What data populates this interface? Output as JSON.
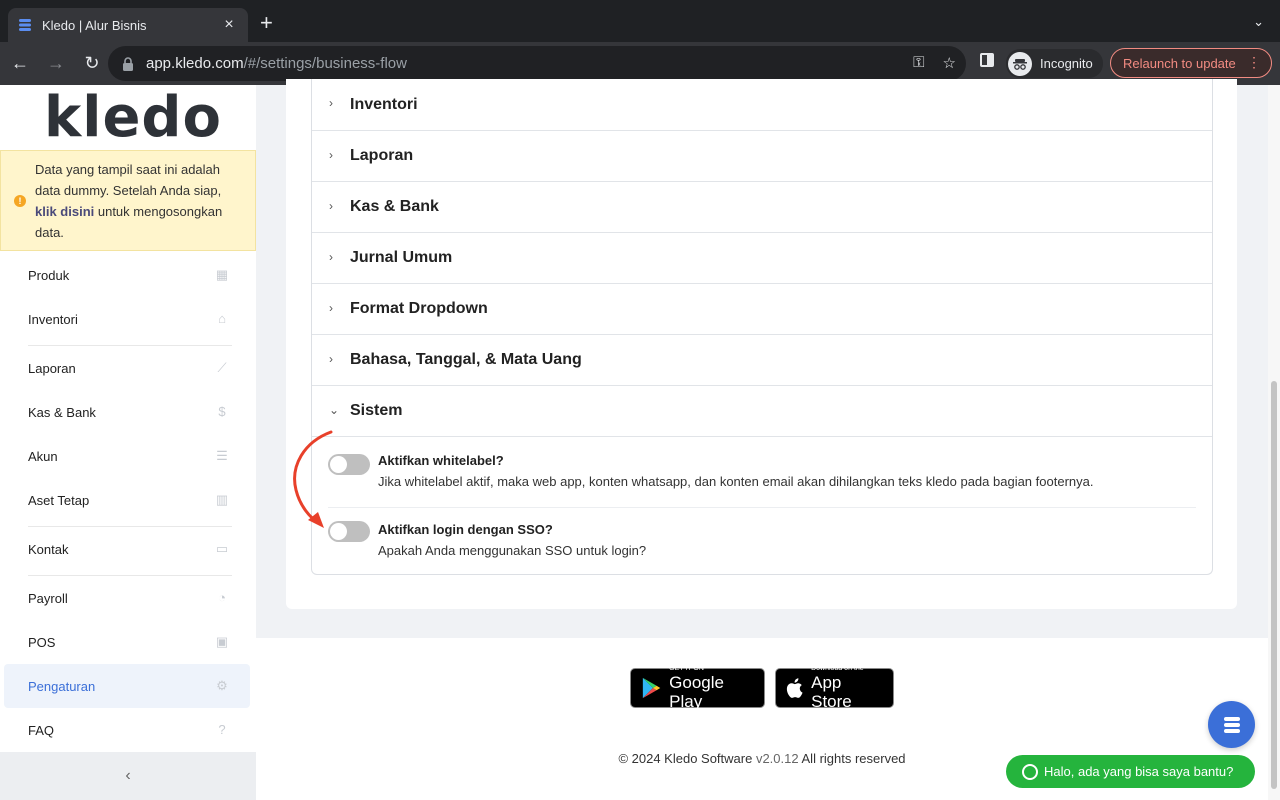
{
  "browser": {
    "tab_title": "Kledo | Alur Bisnis",
    "url_host": "app.kledo.com",
    "url_path": "/#/settings/business-flow",
    "profile_label": "Incognito",
    "relaunch_label": "Relaunch to update"
  },
  "sidebar": {
    "logo_text": "kledo",
    "notice": {
      "text_before": "Data yang tampil saat ini adalah data dummy. Setelah Anda siap, ",
      "link": "klik disini",
      "text_after": " untuk mengosongkan data."
    },
    "items": [
      {
        "label": "Produk",
        "icon": "box-icon"
      },
      {
        "label": "Inventori",
        "icon": "warehouse-icon"
      },
      {
        "label": "Laporan",
        "icon": "chart-icon"
      },
      {
        "label": "Kas & Bank",
        "icon": "dollar-icon"
      },
      {
        "label": "Akun",
        "icon": "list-icon"
      },
      {
        "label": "Aset Tetap",
        "icon": "building-icon"
      },
      {
        "label": "Kontak",
        "icon": "contact-card-icon"
      },
      {
        "label": "Payroll",
        "icon": "payroll-icon"
      },
      {
        "label": "POS",
        "icon": "pos-icon"
      },
      {
        "label": "Pengaturan",
        "icon": "gear-icon"
      },
      {
        "label": "FAQ",
        "icon": "question-icon"
      }
    ],
    "collapse_label": "‹"
  },
  "accordion": {
    "sections": [
      "Inventori",
      "Laporan",
      "Kas & Bank",
      "Jurnal Umum",
      "Format Dropdown",
      "Bahasa, Tanggal, & Mata Uang"
    ],
    "open_section": "Sistem",
    "settings": [
      {
        "title": "Aktifkan whitelabel?",
        "description": "Jika whitelabel aktif, maka web app, konten whatsapp, dan konten email akan dihilangkan teks kledo pada bagian footernya.",
        "enabled": false
      },
      {
        "title": "Aktifkan login dengan SSO?",
        "description": "Apakah Anda menggunakan SSO untuk login?",
        "enabled": false
      }
    ]
  },
  "footer": {
    "google_play": {
      "small": "GET IT ON",
      "big": "Google Play"
    },
    "app_store": {
      "small": "Download on the",
      "big": "App Store"
    },
    "copyright_prefix": "© 2024 Kledo Software ",
    "version": "v2.0.12",
    "copyright_suffix": " All rights reserved"
  },
  "chat": {
    "whatsapp_label": "Halo, ada yang bisa saya bantu?"
  },
  "colors": {
    "brand": "#3b6fd8",
    "notice_bg": "#fff5cc",
    "whatsapp": "#25b43d",
    "annotation_arrow": "#e8402a"
  }
}
